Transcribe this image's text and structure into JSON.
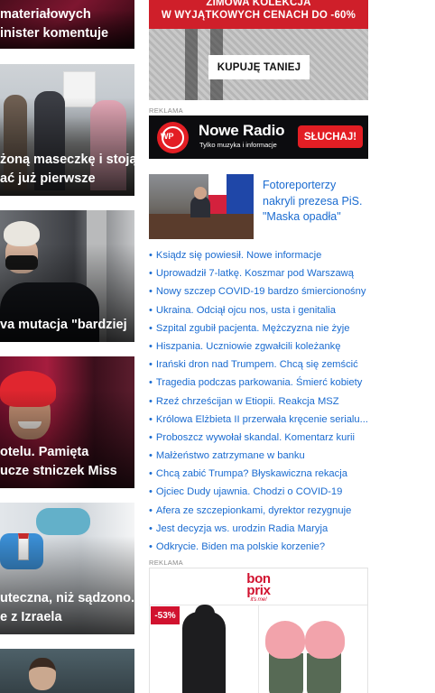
{
  "left_tiles": [
    {
      "line1": "materiałowych",
      "line2": "inister komentuje"
    },
    {
      "line1": "żoną maseczkę i stoją",
      "line2": "ać już pierwsze"
    },
    {
      "line1": "va mutacja \"bardziej",
      "line2": ""
    },
    {
      "line1": "otelu. Pamięta",
      "line2": "ucze stniczek Miss"
    },
    {
      "line1": "uteczna, niż sądzono.",
      "line2": "e z Izraela"
    }
  ],
  "promo": {
    "title_line1": "ZIMOWA KOLEKCJA",
    "title_line2": "W WYJĄTKOWYCH CENACH DO -60%",
    "button": "KUPUJĘ TANIEJ"
  },
  "ads": {
    "label": "REKLAMA"
  },
  "radio_ad": {
    "logo_text": "WP",
    "name": "Nowe Radio",
    "tagline": "Tylko muzyka i informacje",
    "cta": "SŁUCHAJ!"
  },
  "feature": {
    "title_line1": "Fotoreporterzy",
    "title_line2": "nakryli prezesa PiS.",
    "title_line3": "\"Maska opadła\""
  },
  "news": [
    "Ksiądz się powiesił. Nowe informacje",
    "Uprowadził 7-latkę. Koszmar pod Warszawą",
    "Nowy szczep COVID-19 bardzo śmiercionośny",
    "Ukraina. Odciął ojcu nos, usta i genitalia",
    "Szpital zgubił pacjenta. Mężczyzna nie żyje",
    "Hiszpania. Uczniowie zgwałcili koleżankę",
    "Irański dron nad Trumpem. Chcą się zemścić",
    "Tragedia podczas parkowania. Śmierć kobiety",
    "Rzeź chrześcijan w Etiopii. Reakcja MSZ",
    "Królowa Elżbieta II przerwała kręcenie serialu...",
    "Proboszcz wywołał skandal. Komentarz kurii",
    "Małżeństwo zatrzymane w banku",
    "Chcą zabić Trumpa? Błyskawiczna rekacja",
    "Ojciec Dudy ujawnia. Chodzi o COVID-19",
    "Afera ze szczepionkami, dyrektor rezygnuje",
    "Jest decyzja ws. urodzin Radia Maryja",
    "Odkrycie. Biden ma polskie korzenie?"
  ],
  "shop_ad": {
    "logo_line1": "bon",
    "logo_line2": "prix",
    "logo_tagline": "it's me!",
    "discount": "-53%"
  },
  "colors": {
    "link": "#1a6bd0",
    "brand_red": "#d1122f",
    "promo_red": "#cf1f2a",
    "radio_red": "#e31e24"
  }
}
